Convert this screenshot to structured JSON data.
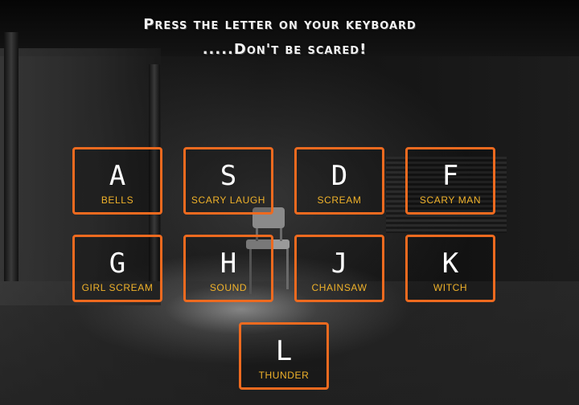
{
  "heading": {
    "line1": "Press the letter on your keyboard",
    "line2": ".....Don't be scared!"
  },
  "keys": [
    {
      "letter": "A",
      "sound": "BELLS"
    },
    {
      "letter": "S",
      "sound": "SCARY LAUGH"
    },
    {
      "letter": "D",
      "sound": "SCREAM"
    },
    {
      "letter": "F",
      "sound": "SCARY MAN"
    },
    {
      "letter": "G",
      "sound": "GIRL SCREAM"
    },
    {
      "letter": "H",
      "sound": "SOUND"
    },
    {
      "letter": "J",
      "sound": "CHAINSAW"
    },
    {
      "letter": "K",
      "sound": "WITCH"
    },
    {
      "letter": "L",
      "sound": "THUNDER"
    }
  ],
  "colors": {
    "accent": "#ee6a1f",
    "label": "#f0b22a",
    "letter": "#ffffff"
  }
}
